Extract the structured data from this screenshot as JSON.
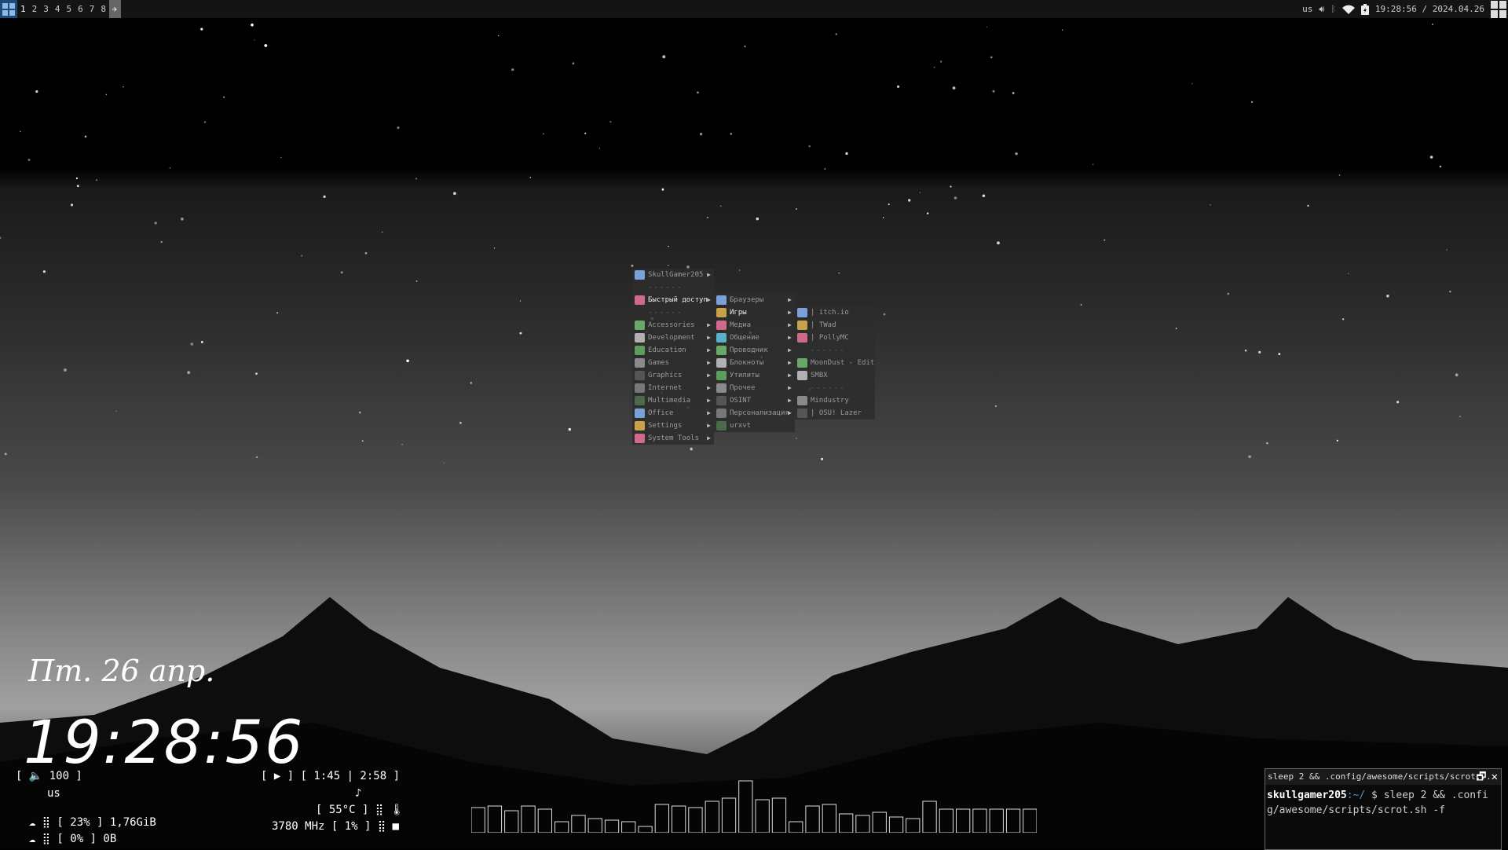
{
  "topbar": {
    "tags": [
      "1",
      "2",
      "3",
      "4",
      "5",
      "6",
      "7",
      "8"
    ],
    "run_icon": "arrow-icon",
    "keyboard_layout": "us",
    "datetime": "19:28:56 / 2024.04.26"
  },
  "menu_main": {
    "items": [
      {
        "label": "SkullGamer205",
        "arrow": "▶"
      },
      {
        "label": "------",
        "separator": true
      },
      {
        "label": "Быстрый доступ",
        "arrow": "▶",
        "selected": true
      },
      {
        "label": "------",
        "separator": true
      },
      {
        "label": "Accessories",
        "arrow": "▶"
      },
      {
        "label": "Development",
        "arrow": "▶"
      },
      {
        "label": "Education",
        "arrow": "▶"
      },
      {
        "label": "Games",
        "arrow": "▶"
      },
      {
        "label": "Graphics",
        "arrow": "▶"
      },
      {
        "label": "Internet",
        "arrow": "▶"
      },
      {
        "label": "Multimedia",
        "arrow": "▶"
      },
      {
        "label": "Office",
        "arrow": "▶"
      },
      {
        "label": "Settings",
        "arrow": "▶"
      },
      {
        "label": "System Tools",
        "arrow": "▶"
      }
    ]
  },
  "menu_quick": {
    "items": [
      {
        "label": "Браузеры",
        "arrow": "▶"
      },
      {
        "label": "Игры",
        "arrow": "▶",
        "selected": true
      },
      {
        "label": "Медиа",
        "arrow": "▶"
      },
      {
        "label": "Общение",
        "arrow": "▶"
      },
      {
        "label": "Проводник",
        "arrow": "▶"
      },
      {
        "label": "Блокноты",
        "arrow": "▶"
      },
      {
        "label": "Утилиты",
        "arrow": "▶"
      },
      {
        "label": "Прочее",
        "arrow": "▶"
      },
      {
        "label": "OSINT",
        "arrow": "▶"
      },
      {
        "label": "Персонализация",
        "arrow": "▶"
      },
      {
        "label": "urxvt",
        "arrow": ""
      }
    ]
  },
  "menu_games": {
    "items": [
      {
        "label": "| itch.io"
      },
      {
        "label": "| TWad"
      },
      {
        "label": "| PollyMC"
      },
      {
        "label": "------",
        "separator": true
      },
      {
        "label": "MoonDust - Edit..."
      },
      {
        "label": "SMBX"
      },
      {
        "label": "------",
        "separator": true
      },
      {
        "label": "Mindustry"
      },
      {
        "label": "| OSU! Lazer"
      }
    ]
  },
  "clock": {
    "date": "Пт. 26 апр.",
    "time": "19:28:56"
  },
  "widgets": {
    "volume": "[ 🔈 100 ]",
    "kb": "us",
    "mem": "[ 23% ] 1,76GiB",
    "swap": "[ 0% ] 0B",
    "media": "[ ▶ ] [ 1:45 | 2:58 ]",
    "note": "♪",
    "temp": "[ 55°C ] ⣿ 🌡",
    "cpu": "3780 MHz [ 1% ] ⣿ ■"
  },
  "terminal": {
    "title": "sleep 2 && .config/awesome/scripts/scrot...",
    "user": "skullgamer205",
    "path": ":~/",
    "prompt": " $ ",
    "command": "sleep 2 && .config/awesome/scripts/scrot.sh -f"
  },
  "visualizer": {
    "levels": [
      0.32,
      0.34,
      0.28,
      0.34,
      0.3,
      0.14,
      0.22,
      0.18,
      0.16,
      0.14,
      0.08,
      0.36,
      0.34,
      0.32,
      0.4,
      0.44,
      0.66,
      0.42,
      0.44,
      0.14,
      0.34,
      0.36,
      0.24,
      0.22,
      0.26,
      0.2,
      0.18,
      0.4,
      0.3,
      0.3,
      0.3,
      0.3,
      0.3,
      0.3
    ]
  },
  "colors": {
    "launcher": "#1e4a78",
    "menu_bg": "rgba(45,45,45,0.85)",
    "terminal_path": "#5b8fcf"
  }
}
